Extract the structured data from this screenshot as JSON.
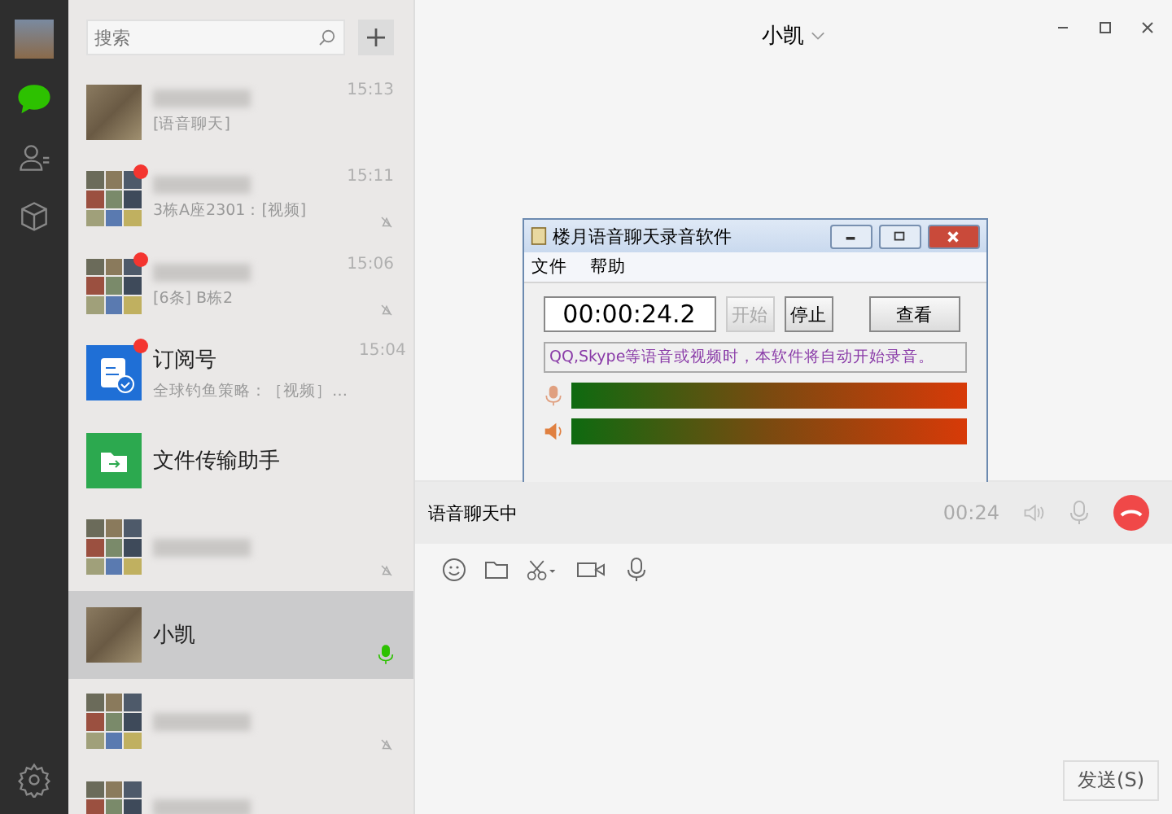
{
  "nav": [
    {
      "kind": "chat",
      "selected": true
    },
    {
      "kind": "contacts",
      "selected": false
    },
    {
      "kind": "box",
      "selected": false
    }
  ],
  "search": {
    "placeholder": "搜索"
  },
  "chats": [
    {
      "kind": "photo",
      "badge": false,
      "preview": "[语音聊天]",
      "time": "15:13",
      "muted": false,
      "selected": false,
      "calling": false
    },
    {
      "kind": "grid",
      "badge": true,
      "preview": "3栋A座2301：[视频]",
      "time": "15:11",
      "muted": true,
      "selected": false,
      "calling": false
    },
    {
      "kind": "grid",
      "badge": true,
      "preview": "[6条] B栋2",
      "time": "15:06",
      "muted": true,
      "selected": false,
      "calling": false
    },
    {
      "kind": "subscription",
      "badge": true,
      "name": "订阅号",
      "preview": "全球钓鱼策略：［视频］…",
      "time": "15:04",
      "muted": false,
      "selected": false,
      "calling": false
    },
    {
      "kind": "file",
      "badge": false,
      "name": "文件传输助手",
      "muted": false,
      "selected": false,
      "calling": false
    },
    {
      "kind": "grid",
      "badge": false,
      "muted": true,
      "selected": false,
      "calling": false
    },
    {
      "kind": "photo",
      "badge": false,
      "name": "小凯",
      "muted": false,
      "selected": true,
      "calling": true
    },
    {
      "kind": "grid",
      "badge": false,
      "muted": true,
      "selected": false,
      "calling": false
    },
    {
      "kind": "grid",
      "badge": false,
      "muted": false,
      "selected": false,
      "calling": false
    }
  ],
  "header": {
    "title": "小凯"
  },
  "recorder": {
    "title": "楼月语音聊天录音软件",
    "menu": [
      "文件",
      "帮助"
    ],
    "timer": "00:00:24.2",
    "buttons": [
      {
        "label": "开始",
        "disabled": true
      },
      {
        "label": "停止",
        "disabled": false
      },
      {
        "label": "查看",
        "disabled": false
      }
    ],
    "message": "QQ,Skype等语音或视频时，本软件将自动开始录音。",
    "meters": [
      {
        "kind": "mic",
        "level": 1
      },
      {
        "kind": "speaker",
        "level": 1
      }
    ]
  },
  "call_bar": {
    "status": "语音聊天中",
    "duration": "00:24"
  },
  "send_button": "发送(S)"
}
